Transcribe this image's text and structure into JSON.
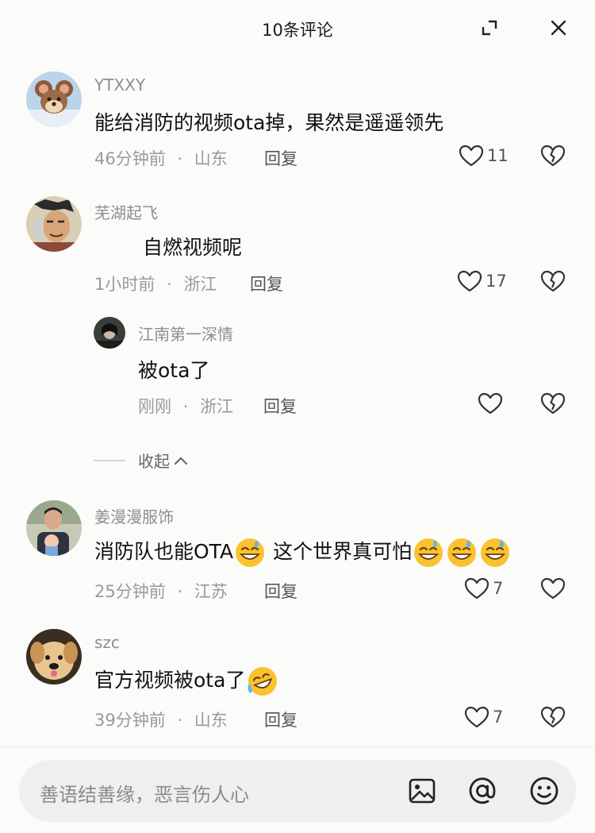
{
  "header": {
    "title": "10条评论"
  },
  "comments": [
    {
      "user": "YTXXY",
      "text": "能给消防的视频ota掉，果然是遥遥领先",
      "time": "46分钟前",
      "location": "山东",
      "reply": "回复",
      "likes": "11"
    },
    {
      "user": "芜湖起飞",
      "text": "自燃视频呢",
      "time": "1小时前",
      "location": "浙江",
      "reply": "回复",
      "likes": "17"
    },
    {
      "user": "江南第一深情",
      "text": "被ota了",
      "time": "刚刚",
      "location": "浙江",
      "reply": "回复",
      "likes": ""
    },
    {
      "user": "姜漫漫服饰",
      "text_a": "消防队也能OTA",
      "text_b": " 这个世界真可怕",
      "time": "25分钟前",
      "location": "江苏",
      "reply": "回复",
      "likes": "7"
    },
    {
      "user": "szc",
      "text": "官方视频被ota了",
      "time": "39分钟前",
      "location": "山东",
      "reply": "回复",
      "likes": "7"
    }
  ],
  "collapse_label": "收起",
  "meta_separator": "·",
  "input": {
    "placeholder": "善语结善缘，恶言伤人心"
  },
  "icons": [
    "expand-icon",
    "close-icon",
    "heart-icon",
    "broken-heart-icon",
    "chevron-up-icon",
    "image-icon",
    "at-icon",
    "smiley-icon",
    "grin-sweat-emoji",
    "rofl-emoji"
  ],
  "colors": {
    "background": "#fbfbfa",
    "username": "#8e8e8e",
    "meta": "#9a9a9a",
    "input_bg": "#efefef"
  }
}
